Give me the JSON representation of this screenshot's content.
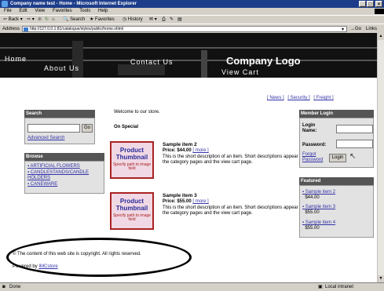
{
  "window": {
    "title": "Company name test - Home - Microsoft Internet Explorer"
  },
  "menu": [
    "File",
    "Edit",
    "View",
    "Favorites",
    "Tools",
    "Help"
  ],
  "toolbar": {
    "back": "Back",
    "search": "Search",
    "favorites": "Favorites",
    "history": "History"
  },
  "address": {
    "label": "Address",
    "url": "http://127.0.0.1:81/catalogue/styles/public/home.shtml",
    "go": "Go",
    "links": "Links"
  },
  "banner": {
    "logo": "Company Logo",
    "nav": {
      "home": "Home",
      "about": "About Us",
      "contact": "Contact Us",
      "cart": "View Cart"
    }
  },
  "toplinks": [
    "[ News ]",
    "[ Security ]",
    "[ Freight ]"
  ],
  "search": {
    "title": "Search",
    "go": "Go",
    "advanced": "Advanced Search"
  },
  "browse": {
    "title": "Browse",
    "items": [
      "ARTIFICIAL FLOWERS",
      "CANDLESTANDS/CANDLE HOLDERS",
      "CANEWARE"
    ]
  },
  "main": {
    "welcome": "Welcome to our store.",
    "special": "On Special",
    "items": [
      {
        "name": "Sample item 2",
        "price": "Price: $44.00",
        "more": "[ more ]",
        "desc": "This is the short description of an item. Short descriptions appear on the category pages and the view cart page.",
        "thumb1": "Product Thumbnail",
        "thumb2": "Specify path to image field"
      },
      {
        "name": "Sample item 3",
        "price": "Price: $55.00",
        "more": "[ more ]",
        "desc": "This is the short description of an item. Short descriptions appear on the category pages and the view cart page.",
        "thumb1": "Product Thumbnail",
        "thumb2": "Specify path to image field"
      }
    ]
  },
  "login": {
    "title": "Member Login",
    "name": "Login Name:",
    "password": "Password:",
    "forgot": "Forgot Password",
    "button": "Login"
  },
  "featured": {
    "title": "Featured",
    "items": [
      {
        "name": "Sample item 2",
        "price": "$44.00"
      },
      {
        "name": "Sample item 3",
        "price": "$55.00"
      },
      {
        "name": "Sample item 4",
        "price": "$55.00"
      }
    ]
  },
  "footer": {
    "copyright": "© The content of this web site is copyright. All rights reserved.",
    "powered_prefix": "Powered by ",
    "powered_link": "IMCstore"
  },
  "status": {
    "left": "Done",
    "zone": "Local intranet"
  }
}
